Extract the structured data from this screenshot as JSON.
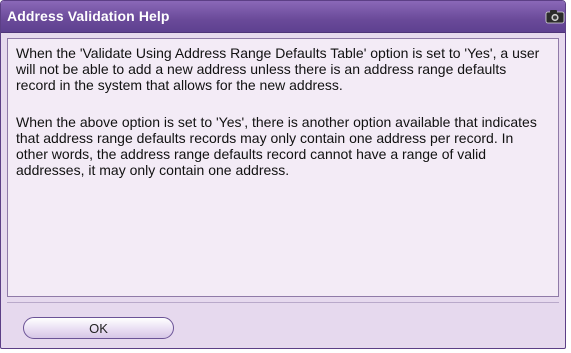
{
  "dialog": {
    "title": "Address Validation Help",
    "icon": "camera-icon",
    "paragraphs": [
      "When the 'Validate Using Address Range Defaults Table' option is set to 'Yes', a user will not be able to add a new address unless there is an address range defaults record in the system that allows for the new address.",
      "When the above option is set to 'Yes', there is another option available that indicates that address range defaults records may only contain one address per record. In other words, the address range defaults record cannot have a range of valid addresses, it may only contain one address."
    ],
    "ok_label": "OK"
  },
  "colors": {
    "title_bar": "#6a4a99",
    "dialog_background": "#e6d9ee",
    "content_background": "#f3ebf6"
  }
}
